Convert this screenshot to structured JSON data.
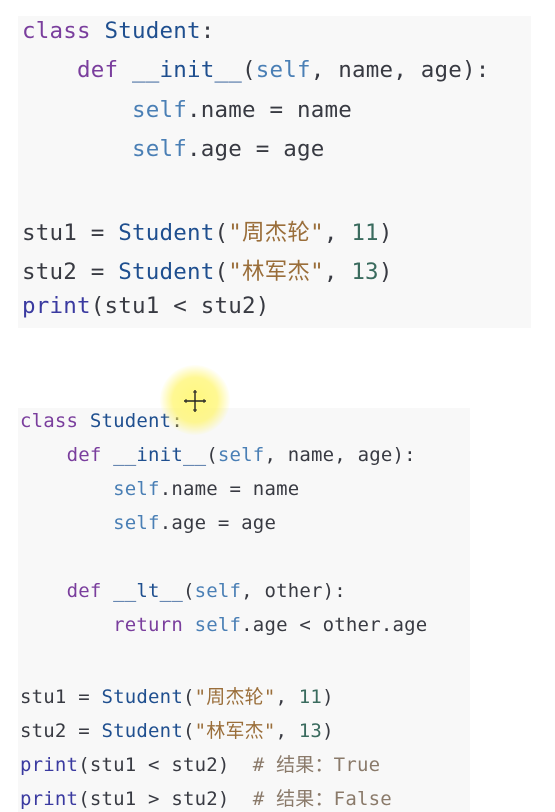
{
  "block1": {
    "lines": [
      [
        {
          "t": "class",
          "c": "kw"
        },
        {
          "t": " "
        },
        {
          "t": "Student",
          "c": "cls"
        },
        {
          "t": ":"
        }
      ],
      [
        {
          "t": "    "
        },
        {
          "t": "def",
          "c": "kw"
        },
        {
          "t": " "
        },
        {
          "t": "__init__",
          "c": "cls"
        },
        {
          "t": "("
        },
        {
          "t": "self",
          "c": "slf"
        },
        {
          "t": ", name, age):"
        }
      ],
      [
        {
          "t": "        "
        },
        {
          "t": "self",
          "c": "slf"
        },
        {
          "t": ".name = name"
        }
      ],
      [
        {
          "t": "        "
        },
        {
          "t": "self",
          "c": "slf"
        },
        {
          "t": ".age = age"
        }
      ],
      [],
      [
        {
          "t": "stu1 = "
        },
        {
          "t": "Student",
          "c": "cls"
        },
        {
          "t": "("
        },
        {
          "t": "\"周杰轮\"",
          "c": "str"
        },
        {
          "t": ", "
        },
        {
          "t": "11",
          "c": "num"
        },
        {
          "t": ")"
        }
      ],
      [
        {
          "t": "stu2 = "
        },
        {
          "t": "Student",
          "c": "cls"
        },
        {
          "t": "("
        },
        {
          "t": "\"林军杰\"",
          "c": "str"
        },
        {
          "t": ", "
        },
        {
          "t": "13",
          "c": "num"
        },
        {
          "t": ")"
        }
      ],
      [
        {
          "t": "print",
          "c": "bi"
        },
        {
          "t": "(stu1 < stu2)"
        }
      ]
    ]
  },
  "block2": {
    "lines": [
      [
        {
          "t": "class",
          "c": "kw"
        },
        {
          "t": " "
        },
        {
          "t": "Student",
          "c": "cls"
        },
        {
          "t": ":"
        }
      ],
      [
        {
          "t": "    "
        },
        {
          "t": "def",
          "c": "kw"
        },
        {
          "t": " "
        },
        {
          "t": "__init__",
          "c": "cls"
        },
        {
          "t": "("
        },
        {
          "t": "self",
          "c": "slf"
        },
        {
          "t": ", name, age):"
        }
      ],
      [
        {
          "t": "        "
        },
        {
          "t": "self",
          "c": "slf"
        },
        {
          "t": ".name = name"
        }
      ],
      [
        {
          "t": "        "
        },
        {
          "t": "self",
          "c": "slf"
        },
        {
          "t": ".age = age"
        }
      ],
      [],
      [
        {
          "t": "    "
        },
        {
          "t": "def",
          "c": "kw"
        },
        {
          "t": " "
        },
        {
          "t": "__lt__",
          "c": "cls"
        },
        {
          "t": "("
        },
        {
          "t": "self",
          "c": "slf"
        },
        {
          "t": ", other):"
        }
      ],
      [
        {
          "t": "        "
        },
        {
          "t": "return",
          "c": "kw"
        },
        {
          "t": " "
        },
        {
          "t": "self",
          "c": "slf"
        },
        {
          "t": ".age < other.age"
        }
      ],
      [],
      [
        {
          "t": "stu1 = "
        },
        {
          "t": "Student",
          "c": "cls"
        },
        {
          "t": "("
        },
        {
          "t": "\"周杰轮\"",
          "c": "str"
        },
        {
          "t": ", "
        },
        {
          "t": "11",
          "c": "num"
        },
        {
          "t": ")"
        }
      ],
      [
        {
          "t": "stu2 = "
        },
        {
          "t": "Student",
          "c": "cls"
        },
        {
          "t": "("
        },
        {
          "t": "\"林军杰\"",
          "c": "str"
        },
        {
          "t": ", "
        },
        {
          "t": "13",
          "c": "num"
        },
        {
          "t": ")"
        }
      ],
      [
        {
          "t": "print",
          "c": "bi"
        },
        {
          "t": "(stu1 < stu2)  "
        },
        {
          "t": "# 结果：True",
          "c": "cmt"
        }
      ],
      [
        {
          "t": "print",
          "c": "bi"
        },
        {
          "t": "(stu1 > stu2)  "
        },
        {
          "t": "# 结果：False",
          "c": "cmt"
        }
      ]
    ]
  },
  "colors": {
    "keyword": "#7a3e9d",
    "class_name": "#1f4f8f",
    "self": "#4a7fb5",
    "string": "#9a6e3a",
    "number": "#3a6b5e",
    "comment": "#8a7a6a",
    "block_background": "#f8f8f8",
    "cursor_highlight": "#fff878"
  },
  "cursor": {
    "icon": "crosshair-move-icon"
  }
}
